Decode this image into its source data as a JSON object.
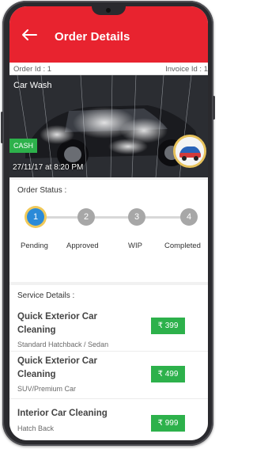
{
  "header": {
    "title": "Order Details"
  },
  "meta": {
    "order_id_label": "Order Id : 1",
    "invoice_id_label": "Invoice Id : 1"
  },
  "hero": {
    "title": "Car Wash",
    "payment_badge": "CASH",
    "datetime": "27/11/17 at 8:20 PM"
  },
  "status": {
    "label": "Order Status :",
    "steps": [
      {
        "number": "1",
        "label": "Pending"
      },
      {
        "number": "2",
        "label": "Approved"
      },
      {
        "number": "3",
        "label": "WIP"
      },
      {
        "number": "4",
        "label": "Completed"
      }
    ],
    "active_step": 1,
    "colors": {
      "active": "#2a8ad8",
      "inactive": "#a7a7a7",
      "ring": "#f0c95a"
    }
  },
  "services": {
    "label": "Service Details :",
    "items": [
      {
        "name": "Quick Exterior Car Cleaning",
        "sub": "Standard Hatchback / Sedan",
        "price": "₹ 399"
      },
      {
        "name": "Quick Exterior Car Cleaning",
        "sub": "SUV/Premium Car",
        "price": "₹ 499"
      },
      {
        "name": "Interior Car Cleaning",
        "sub": "Hatch Back",
        "price": "₹ 999"
      }
    ]
  },
  "colors": {
    "brand": "#e8232f",
    "price_badge": "#2db14b"
  }
}
